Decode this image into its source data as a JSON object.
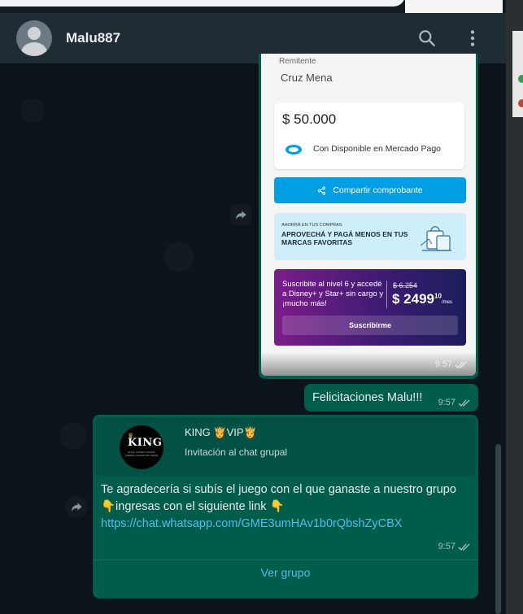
{
  "chat": {
    "contact_name": "Malu887"
  },
  "receipt": {
    "top_label": "Remitente",
    "sender_name": "Cruz Mena",
    "amount": "$ 50.000",
    "source": "Con Disponible en Mercado Pago",
    "share_button": "Compartir comprobante",
    "promo_small": "AHORRÁ EN TUS COMPRAS",
    "promo_main": "APROVECHÁ Y PAGÁ MENOS EN TUS MARCAS FAVORITAS",
    "disney_text": "Suscribite al nivel 6 y accedé a Disney+ y Star+ sin cargo y ¡mucho más!",
    "old_price": "$ 6.254",
    "new_price": "$ 2499",
    "new_price_cents": "10",
    "new_price_unit": "/mes",
    "subscribe_button": "Suscribirme",
    "time": "9:57"
  },
  "message_text": {
    "text": "Felicitaciones Malu!!!",
    "time": "9:57"
  },
  "invite": {
    "group_name": "KING 👸VIP👸",
    "group_sub": "Invitación al chat grupal",
    "logo_text": "KING",
    "logo_sub": "EN EL CASINO ONLINE PUEDES GANAR SIN LIMITE",
    "line1": "Te agradecería si subís el juego con el que ganaste a nuestro grupo",
    "line2": "👇ingresas con el siguiente link 👇",
    "link": "https://chat.whatsapp.com/GME3umHAv1b0rQbshZyCBX",
    "time": "9:57",
    "view_button": "Ver grupo"
  }
}
